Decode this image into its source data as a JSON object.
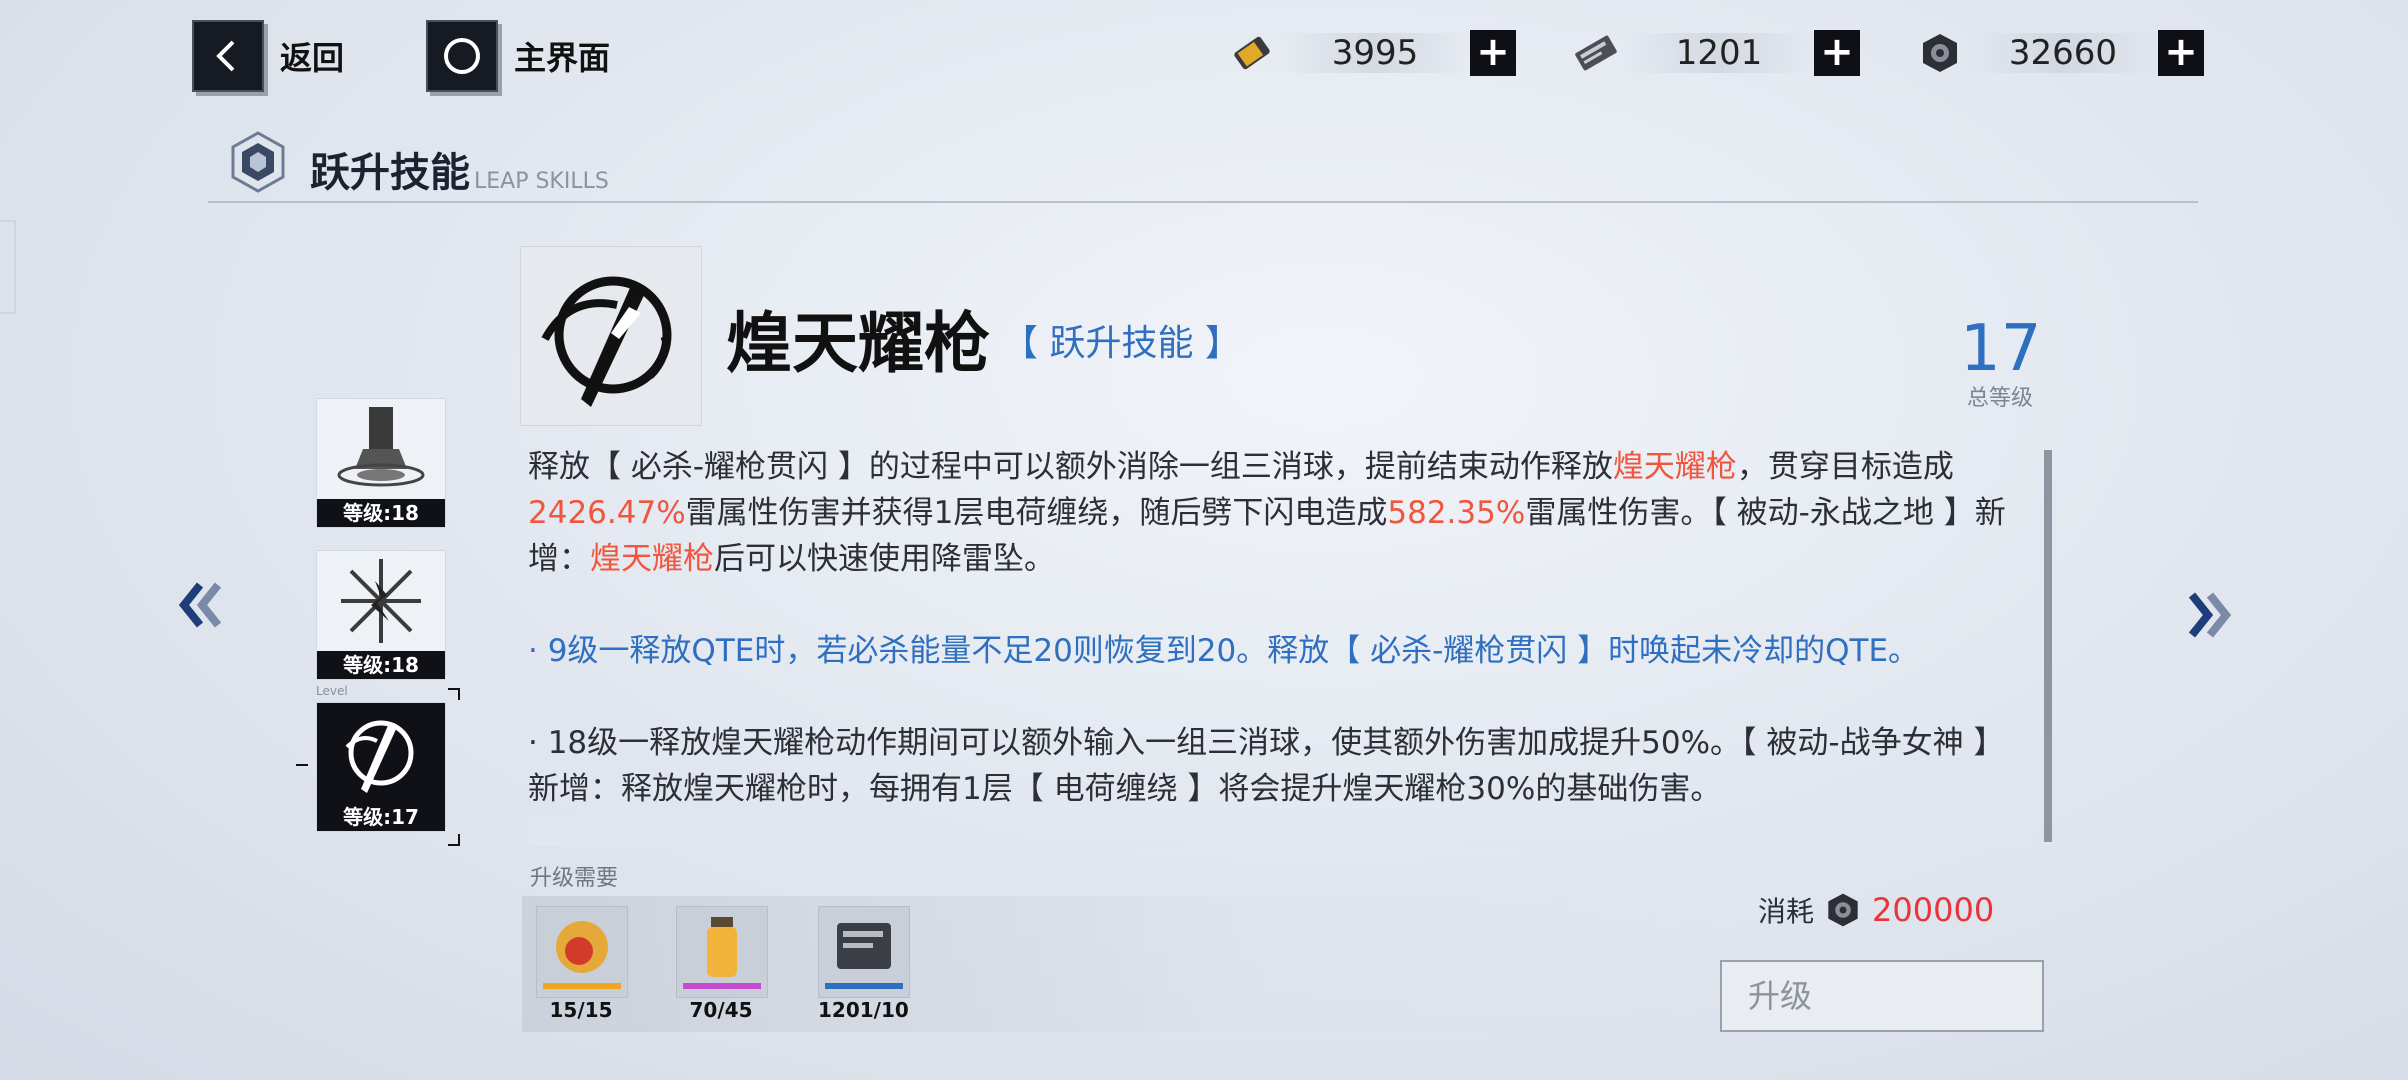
{
  "nav": {
    "back_label": "返回",
    "home_label": "主界面"
  },
  "resources": [
    {
      "icon": "gold-ticket-icon",
      "value": "3995"
    },
    {
      "icon": "supply-card-icon",
      "value": "1201"
    },
    {
      "icon": "hex-coin-icon",
      "value": "32660"
    }
  ],
  "section": {
    "title": "跃升技能",
    "subtitle": "LEAP SKILLS"
  },
  "skill_list": [
    {
      "level_label": "等级:18",
      "icon": "tower-skill-icon"
    },
    {
      "level_label": "等级:18",
      "icon": "lightning-burst-skill-icon"
    },
    {
      "level_label": "等级:17",
      "icon": "spear-skill-icon",
      "small_label": "Level"
    }
  ],
  "skill": {
    "name": "煌天耀枪",
    "tag": "【 跃升技能 】",
    "total_level": "17",
    "total_level_label": "总等级",
    "desc": {
      "a": "释放【 必杀-耀枪贯闪 】的过程中可以额外消除一组三消球，提前结束动作释放",
      "b": "煌天耀枪",
      "c": "，贯穿目标造成",
      "d": "2426.47%",
      "e": "雷属性伤害并获得1层电荷缠绕，随后劈下闪电造成",
      "f": "582.35%",
      "g": "雷属性伤害。【 被动-永战之地 】新增：",
      "h": "煌天耀枪",
      "i": "后可以快速使用降雷坠。",
      "lv9": "· 9级一释放QTE时，若必杀能量不足20则恢复到20。释放【 必杀-耀枪贯闪 】时唤起未冷却的QTE。",
      "lv18": "· 18级一释放煌天耀枪动作期间可以额外输入一组三消球，使其额外伤害加成提升50%。【 被动-战争女神 】新增：释放煌天耀枪时，每拥有1层【 电荷缠绕 】将会提升煌天耀枪30%的基础伤害。"
    }
  },
  "requirements": {
    "label": "升级需要",
    "items": [
      {
        "icon": "character-shard-icon",
        "count": "15/15"
      },
      {
        "icon": "energy-vial-icon",
        "count": "70/45"
      },
      {
        "icon": "supply-card-icon",
        "count": "1201/10"
      }
    ]
  },
  "cost": {
    "label": "消耗",
    "icon": "hex-coin-icon",
    "value": "200000"
  },
  "upgrade_label": "升级"
}
